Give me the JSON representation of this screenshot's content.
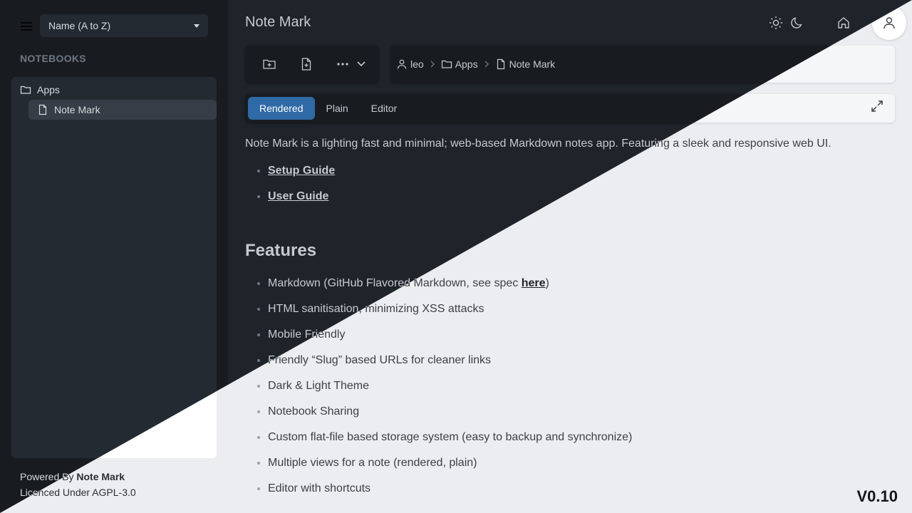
{
  "sidebar": {
    "sort_value": "Name (A to Z)",
    "section_header": "NOTEBOOKS",
    "tree": [
      {
        "label": "Apps",
        "type": "folder",
        "level": 0,
        "active": false
      },
      {
        "label": "Note Mark",
        "type": "note",
        "level": 1,
        "active": true
      }
    ],
    "footer": {
      "powered_prefix": "Powered By",
      "powered_name": "Note Mark",
      "licence": "Licenced Under AGPL-3.0"
    }
  },
  "header": {
    "title": "Note Mark",
    "icons": [
      "sun-icon",
      "moon-icon",
      "home-icon",
      "user-icon"
    ]
  },
  "toolbar": {
    "icons": [
      "new-folder-icon",
      "new-note-icon",
      "more-icon",
      "chevron-down-icon"
    ]
  },
  "breadcrumb": {
    "items": [
      {
        "label": "leo",
        "icon": "user-icon"
      },
      {
        "label": "Apps",
        "icon": "folder-icon"
      },
      {
        "label": "Note Mark",
        "icon": "note-icon"
      }
    ]
  },
  "tabs": {
    "items": [
      "Rendered",
      "Plain",
      "Editor"
    ],
    "active": "Rendered",
    "accent": "#2f6aa6"
  },
  "content": {
    "intro": "Note Mark is a lighting fast and minimal; web-based Markdown notes app. Featuring a sleek and responsive web UI.",
    "links": [
      "Setup Guide",
      "User Guide"
    ],
    "features_heading": "Features",
    "feature_1_text": "Markdown (GitHub Flavored Markdown, see spec ",
    "feature_1_link": "here",
    "feature_1_close": ")",
    "features": [
      "HTML sanitisation, minimizing XSS attacks",
      "Mobile Friendly",
      "Friendly “Slug” based URLs for cleaner links",
      "Dark & Light Theme",
      "Notebook Sharing",
      "Custom flat-file based storage system (easy to backup and synchronize)",
      "Multiple views for a note (rendered, plain)",
      "Editor with shortcuts"
    ]
  },
  "version": "V0.10"
}
